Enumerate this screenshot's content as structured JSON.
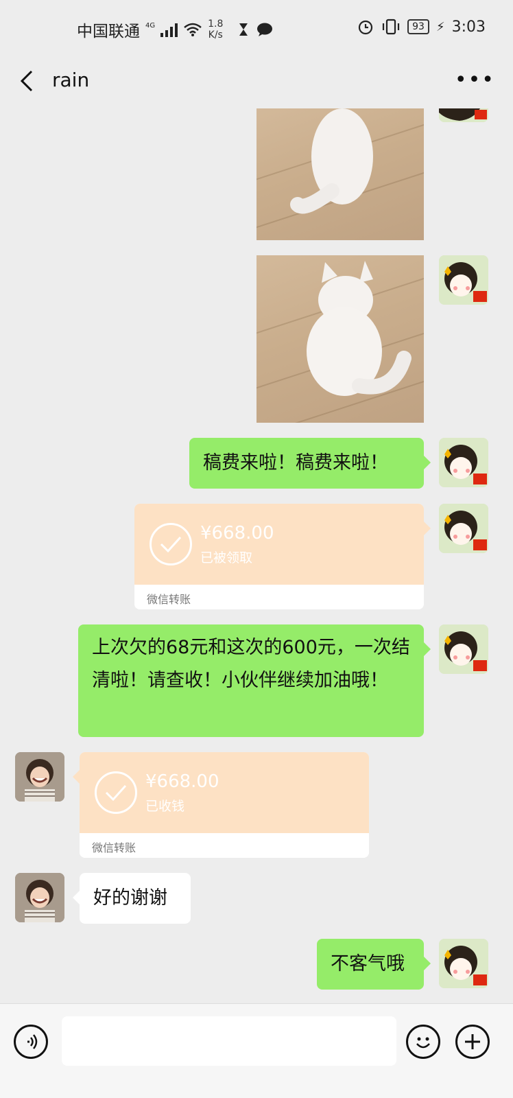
{
  "status_bar": {
    "carrier": "中国联通",
    "network": "4G",
    "speed_value": "1.8",
    "speed_unit": "K/s",
    "battery": "93",
    "time": "3:03"
  },
  "header": {
    "title": "rain"
  },
  "messages": {
    "m1_text": "稿费来啦！稿费来啦！",
    "transfer1": {
      "amount": "¥668.00",
      "status": "已被领取",
      "label": "微信转账"
    },
    "m2_text": "上次欠的68元和这次的600元，一次结清啦！请查收！小伙伴继续加油哦！",
    "transfer2": {
      "amount": "¥668.00",
      "status": "已收钱",
      "label": "微信转账"
    },
    "m3_text": "好的谢谢",
    "m4_text": "不客气哦"
  },
  "colors": {
    "chat_bg": "#ededed",
    "sent_bubble": "#95ec69",
    "received_bubble": "#ffffff",
    "transfer_card": "#fde1c4"
  },
  "icons": [
    "back-arrow-icon",
    "more-icon",
    "voice-icon",
    "emoji-icon",
    "add-icon",
    "alarm-icon",
    "wifi-icon",
    "signal-icon"
  ]
}
